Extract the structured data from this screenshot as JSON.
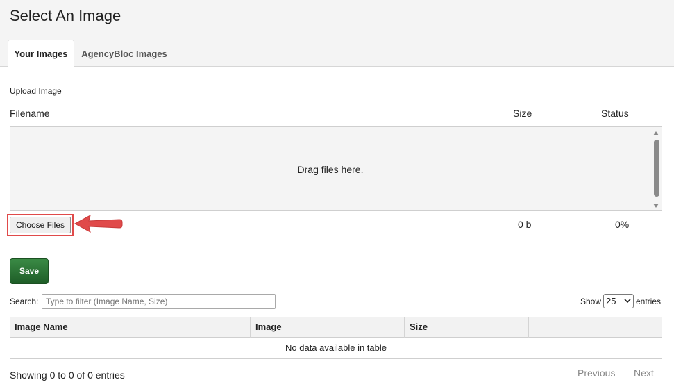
{
  "page": {
    "title": "Select An Image"
  },
  "tabs": [
    {
      "label": "Your Images",
      "active": true
    },
    {
      "label": "AgencyBloc Images",
      "active": false
    }
  ],
  "upload": {
    "label": "Upload Image",
    "columns": {
      "filename": "Filename",
      "size": "Size",
      "status": "Status"
    },
    "dropzone_text": "Drag files here.",
    "choose_files_label": "Choose Files",
    "file_size": "0 b",
    "file_status": "0%"
  },
  "save_label": "Save",
  "search": {
    "label": "Search:",
    "placeholder": "Type to filter (Image Name, Size)",
    "value": ""
  },
  "length": {
    "show_label": "Show",
    "selected": "25",
    "entries_label": "entries"
  },
  "table": {
    "headers": [
      "Image Name",
      "Image",
      "Size",
      "",
      ""
    ],
    "empty_text": "No data available in table"
  },
  "pagination": {
    "info": "Showing 0 to 0 of 0 entries",
    "previous": "Previous",
    "next": "Next"
  },
  "annotation": {
    "color": "#e04a4a",
    "icon": "arrow-left-icon"
  },
  "colors": {
    "save_button": "#2e7a38",
    "header_bg": "#f4f4f4"
  }
}
